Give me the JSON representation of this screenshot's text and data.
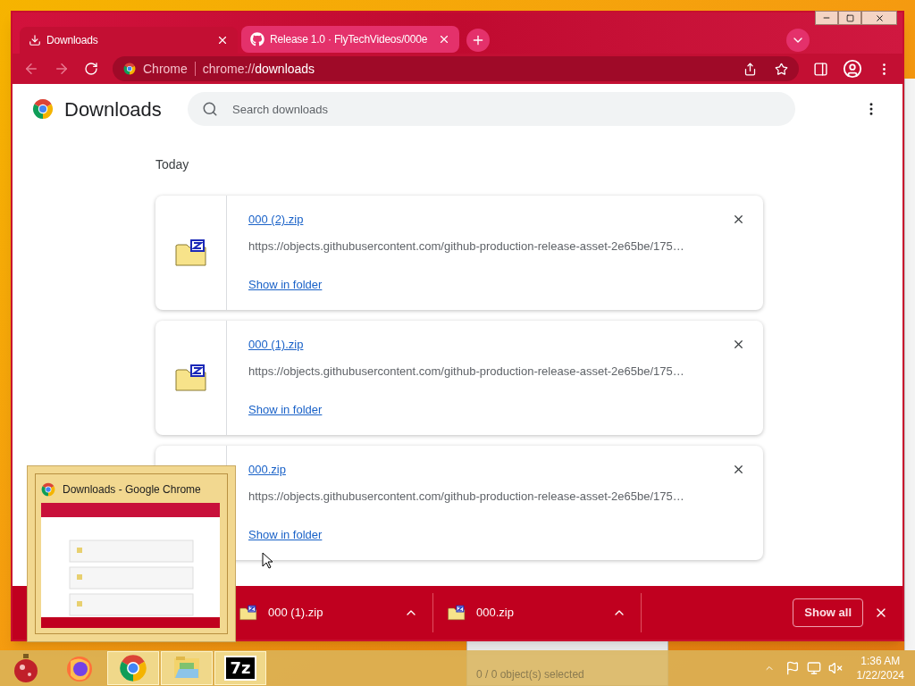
{
  "tabs": [
    {
      "label": "Downloads",
      "kind": "download",
      "selected": true
    },
    {
      "label": "Release 1.0 · FlyTechVideos/000e",
      "kind": "github",
      "selected": false
    }
  ],
  "address_bar": {
    "site_label": "Chrome",
    "url_prefix": "chrome://",
    "url_path": "downloads"
  },
  "page": {
    "title": "Downloads",
    "search": {
      "placeholder": "Search downloads"
    },
    "section": "Today",
    "items": [
      {
        "file": "000 (2).zip",
        "url": "https://objects.githubusercontent.com/github-production-release-asset-2e65be/175…",
        "action": "Show in folder"
      },
      {
        "file": "000 (1).zip",
        "url": "https://objects.githubusercontent.com/github-production-release-asset-2e65be/175…",
        "action": "Show in folder"
      },
      {
        "file": "000.zip",
        "url": "https://objects.githubusercontent.com/github-production-release-asset-2e65be/175…",
        "action": "Show in folder"
      }
    ]
  },
  "shelf": {
    "items": [
      {
        "file": "000 (1).zip"
      },
      {
        "file": "000.zip"
      }
    ],
    "show_all": "Show all"
  },
  "thumbnail": {
    "title": "Downloads - Google Chrome"
  },
  "background_window": {
    "status": "0 / 0 object(s) selected"
  },
  "taskbar": {
    "apps": [
      {
        "kind": "ornament",
        "open": false
      },
      {
        "kind": "firefox",
        "open": false
      },
      {
        "kind": "chrome",
        "open": true
      },
      {
        "kind": "explorer",
        "open": true
      },
      {
        "kind": "sevenzip",
        "label": "7z",
        "open": true
      }
    ],
    "clock": {
      "time": "1:36 AM",
      "date": "1/22/2024"
    }
  }
}
